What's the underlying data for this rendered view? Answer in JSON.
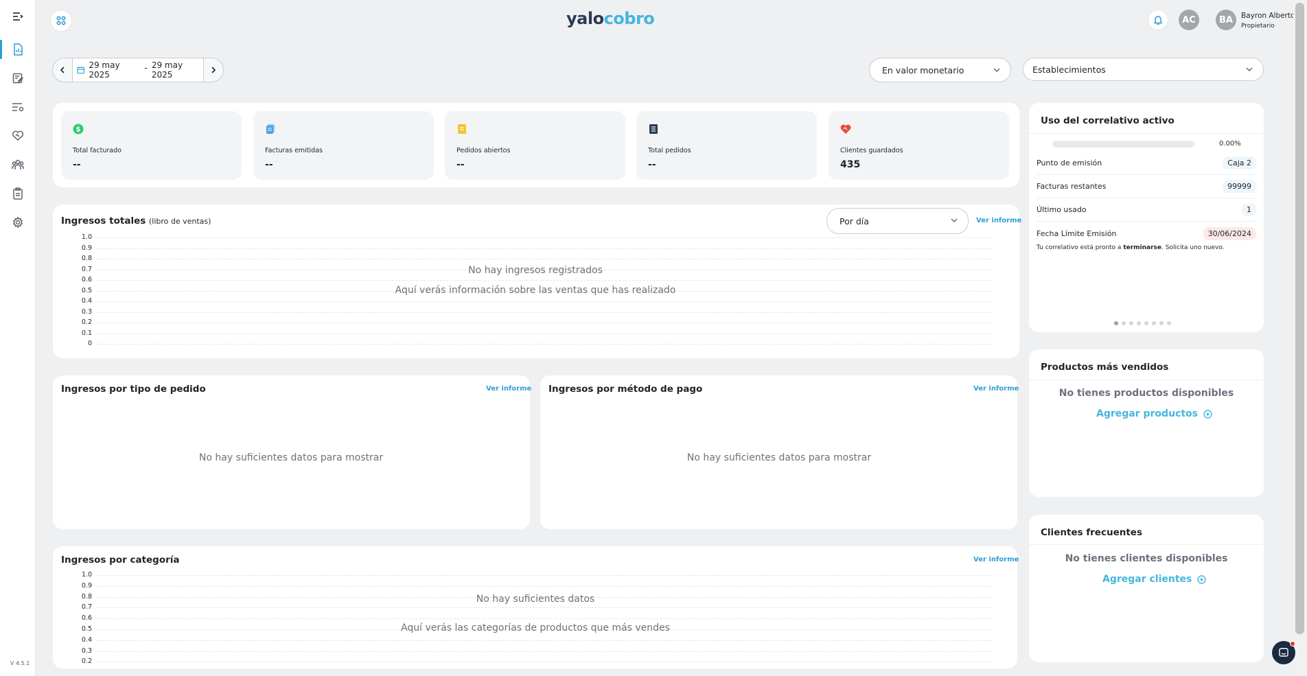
{
  "app": {
    "logo_part1": "yalo",
    "logo_part2": "cobro",
    "version": "V 4.5.1"
  },
  "user": {
    "initials_secondary": "AC",
    "initials": "BA",
    "name": "Bayron Alberto",
    "role": "Propietario"
  },
  "sidebar": {
    "items": [
      {
        "name": "menu-toggle"
      },
      {
        "name": "dashboard",
        "active": true
      },
      {
        "name": "invoices"
      },
      {
        "name": "settings-list"
      },
      {
        "name": "clients-heart"
      },
      {
        "name": "users"
      },
      {
        "name": "orders-clipboard"
      },
      {
        "name": "settings"
      }
    ]
  },
  "filters": {
    "date_from": "29 may 2025",
    "date_sep": "-",
    "date_to": "29 may 2025",
    "mode_select": "En valor monetario",
    "establishments_select": "Establecimientos"
  },
  "stats": [
    {
      "label": "Total facturado",
      "value": "--",
      "icon": "dollar-circle-icon",
      "color": "#2ecc71"
    },
    {
      "label": "Facturas emitidas",
      "value": "--",
      "icon": "documents-icon",
      "color": "#4aa3df"
    },
    {
      "label": "Pedidos abiertos",
      "value": "--",
      "icon": "note-icon",
      "color": "#f4c430"
    },
    {
      "label": "Total pedidos",
      "value": "--",
      "icon": "list-doc-icon",
      "color": "#2b3b55"
    },
    {
      "label": "Clientes guardados",
      "value": "435",
      "icon": "heart-handshake-icon",
      "color": "#e74c3c"
    }
  ],
  "ingresos_totales": {
    "title": "Ingresos totales",
    "subtitle": "(libro de ventas)",
    "period_select": "Por día",
    "link": "Ver informe",
    "empty_title": "No hay ingresos registrados",
    "empty_desc": "Aquí verás información sobre las ventas que has realizado",
    "chart_data": {
      "type": "line",
      "yticks": [
        "1.0",
        "0.9",
        "0.8",
        "0.7",
        "0.6",
        "0.5",
        "0.4",
        "0.3",
        "0.2",
        "0.1",
        "0"
      ],
      "ylim": [
        0,
        1
      ],
      "series": []
    }
  },
  "tipo_pedido": {
    "title": "Ingresos por tipo de pedido",
    "link": "Ver informe",
    "empty": "No hay suficientes datos para mostrar"
  },
  "metodo_pago": {
    "title": "Ingresos por método de pago",
    "link": "Ver informe",
    "empty": "No hay suficientes datos para mostrar"
  },
  "categoria": {
    "title": "Ingresos por categoría",
    "link": "Ver informe",
    "empty_title": "No hay suficientes datos",
    "empty_desc": "Aquí verás las categorías de productos que más vendes",
    "chart_data": {
      "type": "bar",
      "yticks": [
        "1.0",
        "0.9",
        "0.8",
        "0.7",
        "0.6",
        "0.5",
        "0.4",
        "0.3",
        "0.2"
      ],
      "series": []
    }
  },
  "correlativo": {
    "title": "Uso del correlativo activo",
    "progress_label": "0.00%",
    "progress_fraction": 0.0,
    "rows": [
      {
        "label": "Punto de emisión",
        "value": "Caja 2"
      },
      {
        "label": "Facturas restantes",
        "value": "99999"
      },
      {
        "label": "Último usado",
        "value": "1"
      },
      {
        "label": "Fecha Límite Emisión",
        "value": "30/06/2024"
      }
    ],
    "note_pre": "Tu correlativo está pronto a ",
    "note_bold": "terminarse",
    "note_post": ". Solicita uno nuevo.",
    "dots_count": 8
  },
  "productos": {
    "title": "Productos más vendidos",
    "empty": "No tienes productos disponibles",
    "add": "Agregar productos"
  },
  "clientes": {
    "title": "Clientes frecuentes",
    "empty": "No tienes clientes disponibles",
    "add": "Agregar clientes"
  }
}
